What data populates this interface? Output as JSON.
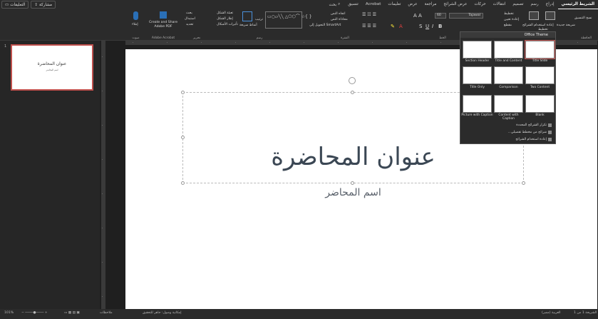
{
  "tabs": {
    "items": [
      "الشريط الرئيسي",
      "إدراج",
      "رسم",
      "تصميم",
      "انتقالات",
      "حركات",
      "عرض الشرائح",
      "مراجعة",
      "عرض",
      "تعليمات",
      "Acrobat",
      "تنسيق"
    ],
    "search_label": "بحث",
    "share_label": "مشاركة",
    "comments_label": "التعليقات"
  },
  "ribbon": {
    "clipboard_label": "الحافظة",
    "slides_label": "الشرائح",
    "new_slide": "شريحة جديدة",
    "layout": "تخطيط",
    "reuse_slides": "إعادة استخدام الشرائح",
    "reset": "إعادة تعيين",
    "section": "مقطع",
    "font_name": "Tajawal",
    "font_size": "60",
    "font_label": "الخط",
    "paragraph_label": "الفقرة",
    "text_direction": "اتجاه النص",
    "align_text": "محاذاة النص",
    "convert_smartart": "التحويل إلى SmartArt",
    "drawing_label": "رسم",
    "arrange": "ترتيب",
    "quick_styles": "أنماط سريعة",
    "shape_fill": "تعبئة الشكل",
    "shape_outline": "إطار الشكل",
    "shape_effects": "تأثيرات الأشكال",
    "find": "بحث",
    "replace": "استبدال",
    "select": "تحديد",
    "editing_label": "تحرير",
    "acrobat_create": "Create and Share Adobe PDF",
    "acrobat_label": "Adobe Acrobat",
    "dictate": "إملاء",
    "voice_label": "صوت",
    "format_painter": "نسخ التنسيق",
    "paste": "لصق"
  },
  "layout_menu": {
    "header": "Office Theme",
    "layouts": [
      "Title Slide",
      "Title and Content",
      "Section Header",
      "Two Content",
      "Comparison",
      "Title Only",
      "Blank",
      "Content with Caption",
      "Picture with Caption"
    ],
    "duplicate": "تكرار الشرائح المحددة",
    "outline": "شرائح من مخطط تفصيلي...",
    "reuse": "إعادة استخدام الشرائح"
  },
  "thumbnail": {
    "number": "1",
    "title": "عنوان المحاضرة",
    "subtitle": "اسم المحاضر"
  },
  "slide": {
    "title": "عنوان المحاضرة",
    "subtitle": "اسم المحاضر"
  },
  "status": {
    "slide_info": "الشريحة 1 من 1",
    "language": "العربية (مصر)",
    "accessibility": "إمكانية وصول: جاهز للتحقيق",
    "notes": "ملاحظات",
    "zoom": "101%"
  }
}
